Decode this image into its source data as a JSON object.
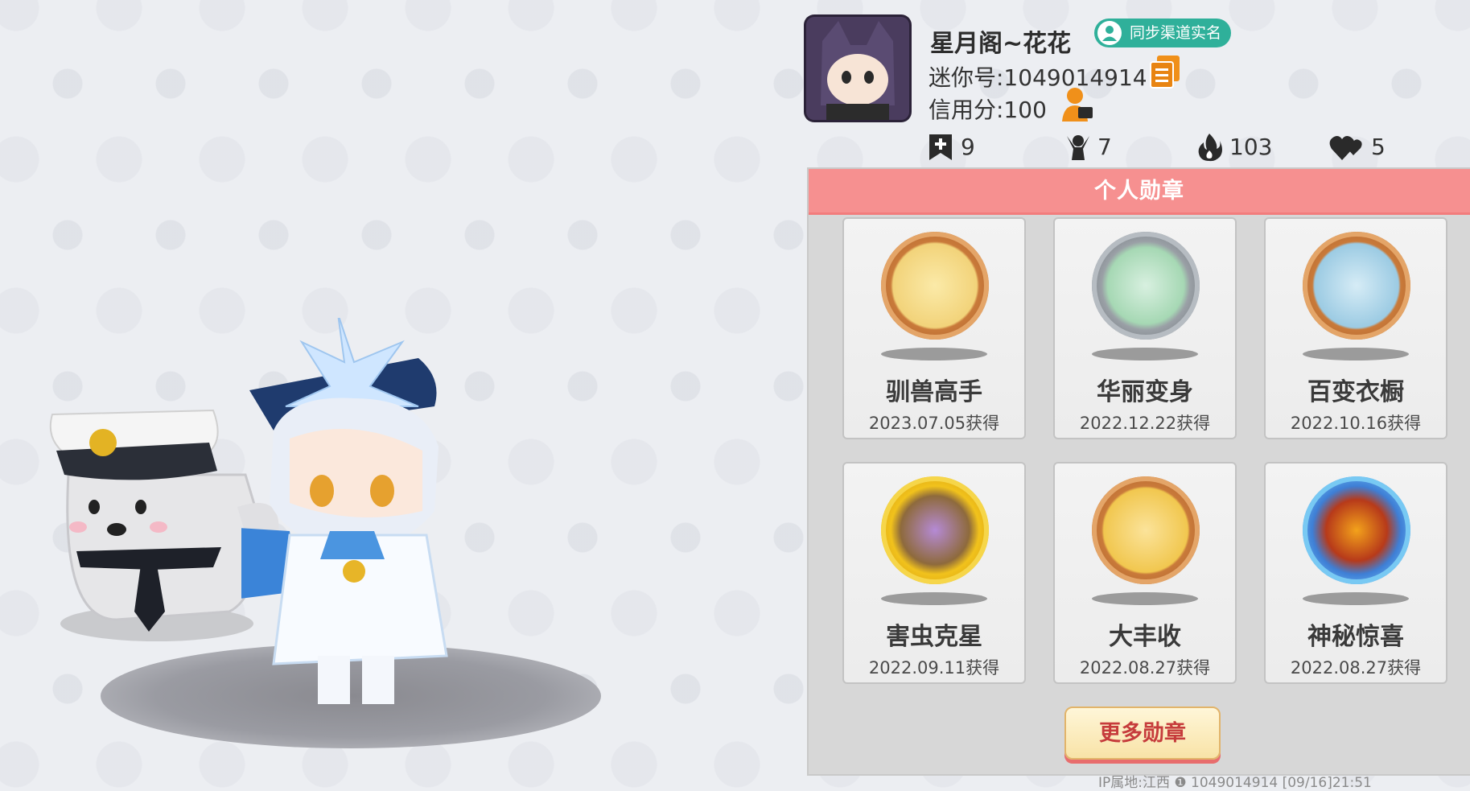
{
  "profile": {
    "name": "星月阁~花花",
    "verify_badge": "同步渠道实名",
    "mini_id": "迷你号:1049014914",
    "credit_score": "信用分:100"
  },
  "stats": [
    {
      "icon": "add-bookmark-icon",
      "value": "9"
    },
    {
      "icon": "fans-icon",
      "value": "7"
    },
    {
      "icon": "flame-icon",
      "value": "103"
    },
    {
      "icon": "hearts-icon",
      "value": "5"
    }
  ],
  "medals": {
    "title": "个人勋章",
    "items": [
      {
        "name": "驯兽高手",
        "date": "2023.07.05获得"
      },
      {
        "name": "华丽变身",
        "date": "2022.12.22获得"
      },
      {
        "name": "百变衣橱",
        "date": "2022.10.16获得"
      },
      {
        "name": "害虫克星",
        "date": "2022.09.11获得"
      },
      {
        "name": "大丰收",
        "date": "2022.08.27获得"
      },
      {
        "name": "神秘惊喜",
        "date": "2022.08.27获得"
      }
    ],
    "more_button": "更多勋章"
  },
  "footer": {
    "text": "IP属地:江西 ❶    1049014914    [09/16]21:51"
  },
  "colors": {
    "medals_header": "#f69090",
    "verify_badge": "#2fb09a",
    "more_button_text": "#c63c3c"
  }
}
